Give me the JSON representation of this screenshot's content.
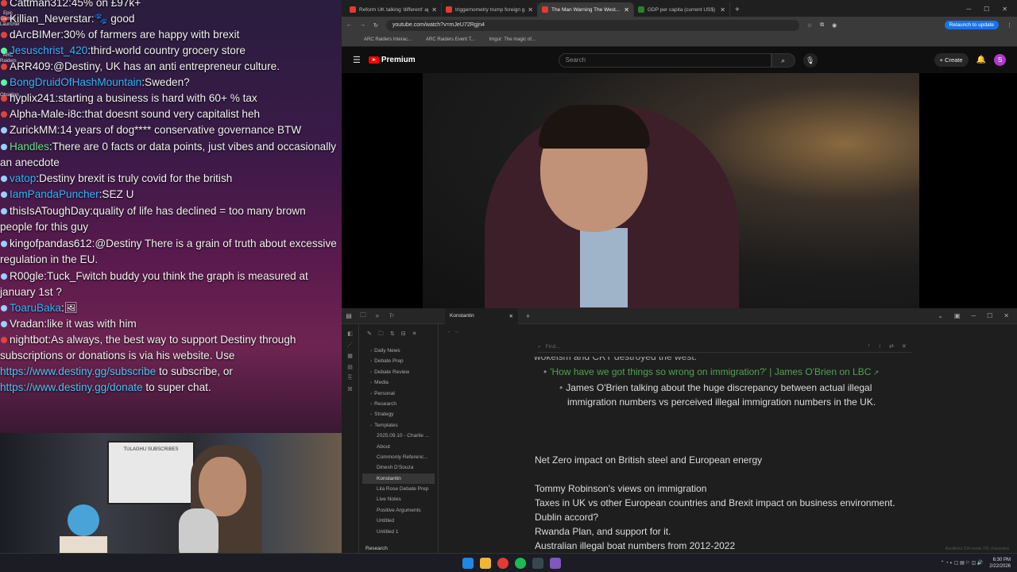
{
  "chat": [
    {
      "user": "Cattman312",
      "msg": "45% on £97k+",
      "color": "#f5f5f5",
      "badge": "#e0443a"
    },
    {
      "user": "Killian_Neverstar",
      "msg": "🐾 good",
      "color": "#f5f5f5",
      "badge": "#e0443a"
    },
    {
      "user": "dArcBIMer",
      "msg": "30% of farmers are happy with brexit",
      "color": "#f5f5f5",
      "badge": "#e0443a"
    },
    {
      "user": "Jesuschrist_420",
      "msg": "third-world country grocery store",
      "color": "#35b5ff",
      "badge": "#5f9"
    },
    {
      "user": "ARR409",
      "msg": "@Destiny, UK has an anti entrepreneur culture.",
      "color": "#f5f5f5",
      "badge": "#e0443a"
    },
    {
      "user": "BongDruidOfHashMountain",
      "msg": "Sweden?",
      "color": "#35b5ff",
      "badge": "#5f9"
    },
    {
      "user": "hyplix241",
      "msg": "starting a business is hard with 60+ % tax",
      "color": "#f5f5f5",
      "badge": "#e0443a"
    },
    {
      "user": "Alpha-Male-i8c",
      "msg": "that doesnt sound very capitalist heh",
      "color": "#f5f5f5",
      "badge": "#e0443a"
    },
    {
      "user": "ZurickMM",
      "msg": "14 years of dog**** conservative governance BTW",
      "color": "#f5f5f5",
      "badge": "#9ad0ff"
    },
    {
      "user": "Handles",
      "msg": "There are 0 facts or data points, just vibes and occasionally an anecdote",
      "color": "#6fe08a",
      "badge": "#9ad0ff"
    },
    {
      "user": "vatop",
      "msg": "Destiny brexit is truly covid for the british",
      "color": "#35b5ff",
      "badge": "#9ad0ff"
    },
    {
      "user": "IamPandaPuncher",
      "msg": "SEZ U",
      "color": "#35b5ff",
      "badge": "#9ad0ff"
    },
    {
      "user": "thisIsAToughDay",
      "msg": "quality of life has declined = too many brown people for this guy",
      "color": "#f5f5f5",
      "badge": "#9ad0ff"
    },
    {
      "user": "kingofpandas612",
      "msg": "@Destiny There is a grain of truth about excessive regulation in the EU.",
      "color": "#f5f5f5",
      "badge": "#9ad0ff"
    },
    {
      "user": "R00gle",
      "msg": "Tuck_Fwitch buddy you think the graph is measured at january 1st ?",
      "color": "#f5f5f5",
      "badge": "#9ad0ff"
    },
    {
      "user": "ToaruBaka",
      "msg": "🖼",
      "color": "#35b5ff",
      "badge": "#9ad0ff"
    },
    {
      "user": "Vradan",
      "msg": "like it was with him",
      "color": "#f5f5f5",
      "badge": "#9ad0ff"
    },
    {
      "user": "nightbot",
      "msg": "As always, the best way to support Destiny through subscriptions or donations is via his website. Use",
      "color": "#f5f5f5",
      "badge": "#e0443a",
      "link1": "https://www.destiny.gg/subscribe",
      "mid": " to subscribe, or ",
      "link2": "https://www.destiny.gg/donate",
      "tail": " to super chat."
    }
  ],
  "desktop_icons": [
    "Epic Games Launcher",
    "ARC Raiders",
    "Obsidian"
  ],
  "webcam": {
    "poster_text": "TULAGHU SUBSCRIBES"
  },
  "browser": {
    "tabs": [
      {
        "title": "Reform UK talking 'different' ap...",
        "color": "#e53935"
      },
      {
        "title": "triggernometry trump foreign g...",
        "color": "#e53935"
      },
      {
        "title": "The Man Warning The West...",
        "color": "#e53935",
        "active": true
      },
      {
        "title": "GDP per capita (current US$) -...",
        "color": "#2e7d32"
      }
    ],
    "url": "youtube.com/watch?v=mJeU72Rgjn4",
    "relaunch": "Relaunch to update",
    "bookmarks": [
      "ARC Raiders Interac...",
      "ARC Raiders Event T...",
      "Imgur: The magic of..."
    ]
  },
  "youtube": {
    "brand": "Premium",
    "search_placeholder": "Search",
    "create": "Create",
    "avatar": "S"
  },
  "obsidian": {
    "tab": "Konstantin",
    "find_placeholder": "Find...",
    "tree": [
      {
        "label": "Daily News",
        "folder": true
      },
      {
        "label": "Debate Prep",
        "folder": true
      },
      {
        "label": "Debate Review",
        "folder": true
      },
      {
        "label": "Media",
        "folder": true
      },
      {
        "label": "Personal",
        "folder": true
      },
      {
        "label": "Research",
        "folder": true
      },
      {
        "label": "Strategy",
        "folder": true
      },
      {
        "label": "Templates",
        "folder": true
      },
      {
        "label": "2025.09.10 - Charlie ...",
        "folder": false
      },
      {
        "label": "About",
        "folder": false
      },
      {
        "label": "Commonly Referenc...",
        "folder": false
      },
      {
        "label": "Dinesh D'Souza",
        "folder": false
      },
      {
        "label": "Konstantin",
        "folder": false,
        "selected": true
      },
      {
        "label": "Lila Rose Debate Prep",
        "folder": false
      },
      {
        "label": "Live Notes",
        "folder": false
      },
      {
        "label": "Positive Arguments",
        "folder": false
      },
      {
        "label": "Untitled",
        "folder": false
      },
      {
        "label": "Untitled 1",
        "folder": false
      }
    ],
    "vault": "Research",
    "lines": {
      "cut": "wokeism and CRT destroyed the west.",
      "link": "'How have we got things so wrong on immigration?' | James O'Brien on LBC",
      "sub1": "James O'Brien talking about the huge discrepancy between actual illegal",
      "sub2": "immigration numbers vs perceived illegal immigration numbers in the UK.",
      "l1": "Net Zero impact on British steel and European energy",
      "l2": "Tommy Robinson's views on immigration",
      "l3": "Taxes in UK vs other European countries and Brexit impact on business environment.",
      "l4": "Dublin accord?",
      "l5": "Rwanda Plan, and support for it.",
      "l6": "Australian illegal boat numbers from 2012-2022"
    },
    "status": "Backlinks   134 words   791 characters"
  },
  "taskbar": {
    "time": "6:30 PM",
    "date": "2/22/2026"
  }
}
